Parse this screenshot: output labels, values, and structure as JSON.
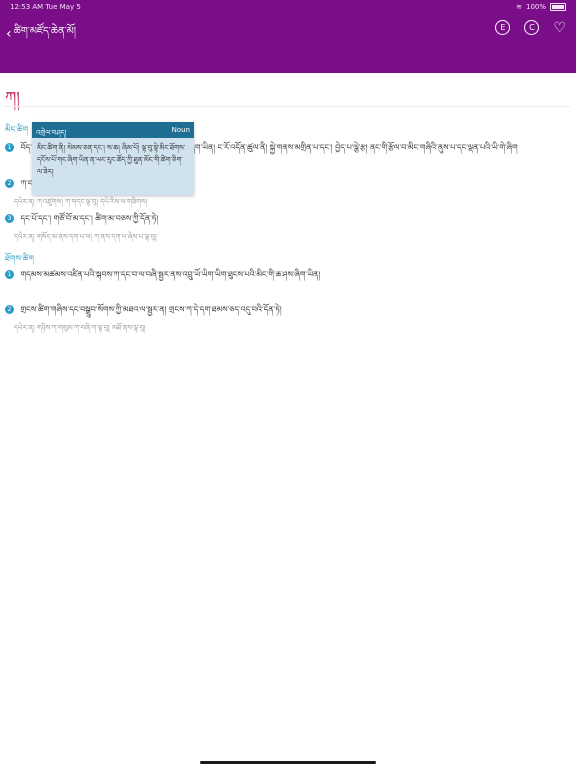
{
  "status_bar": {
    "time": "12:53 AM  Tue May 5",
    "wifi": "wifi-icon",
    "battery": "100%"
  },
  "navbar": {
    "back_label": "ཚིག་མཛོད་ཆེན་མོ།",
    "icons": [
      "back-chevron-icon",
      "e-circle-icon",
      "c-circle-icon",
      "heart-icon"
    ],
    "e_label": "E",
    "c_label": "C"
  },
  "entry": {
    "headword": "ཀ།",
    "section1_label": "མིང་ཚིག",
    "definitions": [
      {
        "num": "1",
        "text": "བོད་ཀྱི་གསལ་བྱེད་ཀྱི་ཡི་གེ་དང་པོ་སྟེ། མགྲིན་པ་ནས་སྐྱེ་བའི་ཡི་གེ་ཞིག་ཡིན། ང་རོ་འདོན་ཚུལ་ནི། སྐྱེ་གནས་མགྲིན་པ་དང་། བྱེད་པ་ལྕེ་རྩ། ནང་གི་རྩོལ་བ་མིང་གཞིའི་ནུས་པ་དང་ལྡན་པའི་ཡི་གེ་ཞིག"
      },
      {
        "num": "2",
        "text": "ཀ་བ",
        "example": "དཔེར་ན། ཀ་འཛུགས། ཀ་གདང་ལྟ་བུ། དཔེ་རིས་ལ་གཟིགས།"
      },
      {
        "num": "3",
        "text": "དང་པོ་དང་། གཙོ་བོ་མ་དང་། ཚིག་མ་བཅས་ཀྱི་དོན་ཏེ།",
        "example": "དཔེར་ན། གསོད་མ་ནས་དག་པ་ལ། ཀ་ནས་དག་པ་ཞེས་པ་ལྟ་བུ།"
      }
    ],
    "section2_label": "ཐོགས་ཚིག",
    "definitions2": [
      {
        "num": "1",
        "text": "གདམས་མཚམས་འཛིན་པའི་སྐབས་ཀ་དང་བ་ལ་བཞི་སྦྱར་ནས་འབྲུ་ཡོ་ཡིག་ཡིག་ཐུངས་པའི་མིང་གི་ཆ་ཤས་ཞིག་ཡིན།"
      },
      {
        "num": "2",
        "text": "གྲངས་ཚིག་གཞིས་དང་བསྒྲུབ་སོགས་ཀྱི་མཐའ་ལ་སྦྱར་ན། གྲངས་ཀ་དེ་དག་ཐམས་ཅད་འདུ་བའི་དོན་ཏེ།",
        "example": "དཔེར་ན། གཉིས་ཀ་གསུམ་ཀ་བཞི་ཀ་ལྟ་བུ། མཐོ་ནས་ལྟ་བུ།"
      }
    ]
  },
  "popup": {
    "title": "འགྲེལ་བཤད།",
    "pos": "Noun",
    "body": "མིང་ཚིག་ནི། སེམས་ཅན་དང་། ས་ཆ། ཞིམ་པོ། ལྟ་བུ་སྟེ་མིང་ཐོགས་དངོས་པོ་གང་ཞིག་ཡིན་ན་ཡང་རུང་ཚོད་ཀྱི་ཐུན་མོང་གི་ཚིག་ཅིག་ལ་ཟེར།"
  }
}
